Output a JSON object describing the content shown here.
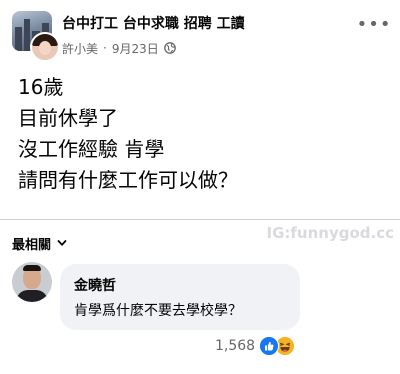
{
  "header": {
    "group_name": "台中打工 台中求職 招聘 工讀",
    "author": "許小美",
    "separator": "·",
    "date": "9月23日",
    "more_label": "•••",
    "privacy_icon": "globe-icon"
  },
  "post": {
    "lines": [
      "16歲",
      "目前休學了",
      "沒工作經驗 肯學",
      "請問有什麼工作可以做？"
    ]
  },
  "comments": {
    "sort_label": "最相關",
    "watermark": "IG:funnygod.cc",
    "items": [
      {
        "author": "金曉哲",
        "text": "肯學爲什麼不要去學校學？",
        "reaction_count": "1,568",
        "reaction_icons": [
          "like-icon",
          "haha-icon"
        ]
      }
    ]
  },
  "colors": {
    "text": "#050505",
    "secondary_text": "#65676b",
    "bubble": "#f0f2f5",
    "like_blue": "#1877f2",
    "haha_yellow": "#f7b125"
  }
}
